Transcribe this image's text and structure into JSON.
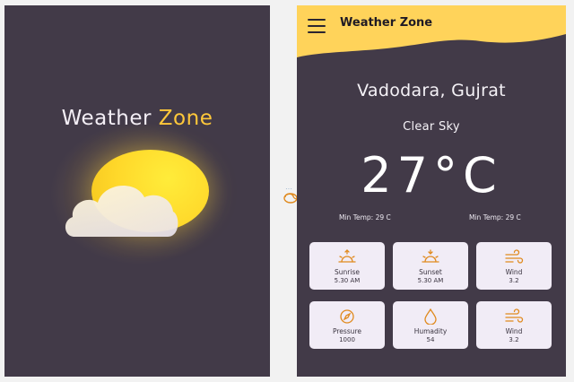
{
  "splash": {
    "title_part1": "Weather",
    "title_part2": "Zone"
  },
  "main": {
    "app_title": "Weather Zone",
    "city": "Vadodara, Gujrat",
    "condition": "Clear Sky",
    "temperature": "27°C",
    "min_temp_left": "Min Temp: 29 C",
    "min_temp_right": "Min Temp: 29 C",
    "cards": [
      {
        "label": "Sunrise",
        "value": "5.30 AM",
        "icon": "sunrise-icon"
      },
      {
        "label": "Sunset",
        "value": "5.30 AM",
        "icon": "sunset-icon"
      },
      {
        "label": "Wind",
        "value": "3.2",
        "icon": "wind-icon"
      },
      {
        "label": "Pressure",
        "value": "1000",
        "icon": "compass-icon"
      },
      {
        "label": "Humadity",
        "value": "54",
        "icon": "drop-icon"
      },
      {
        "label": "Wind",
        "value": "3.2",
        "icon": "wind-icon"
      }
    ]
  },
  "colors": {
    "background": "#423a48",
    "accent": "#ffc83a",
    "card": "#f1ecf6",
    "icon": "#e08a1e"
  }
}
